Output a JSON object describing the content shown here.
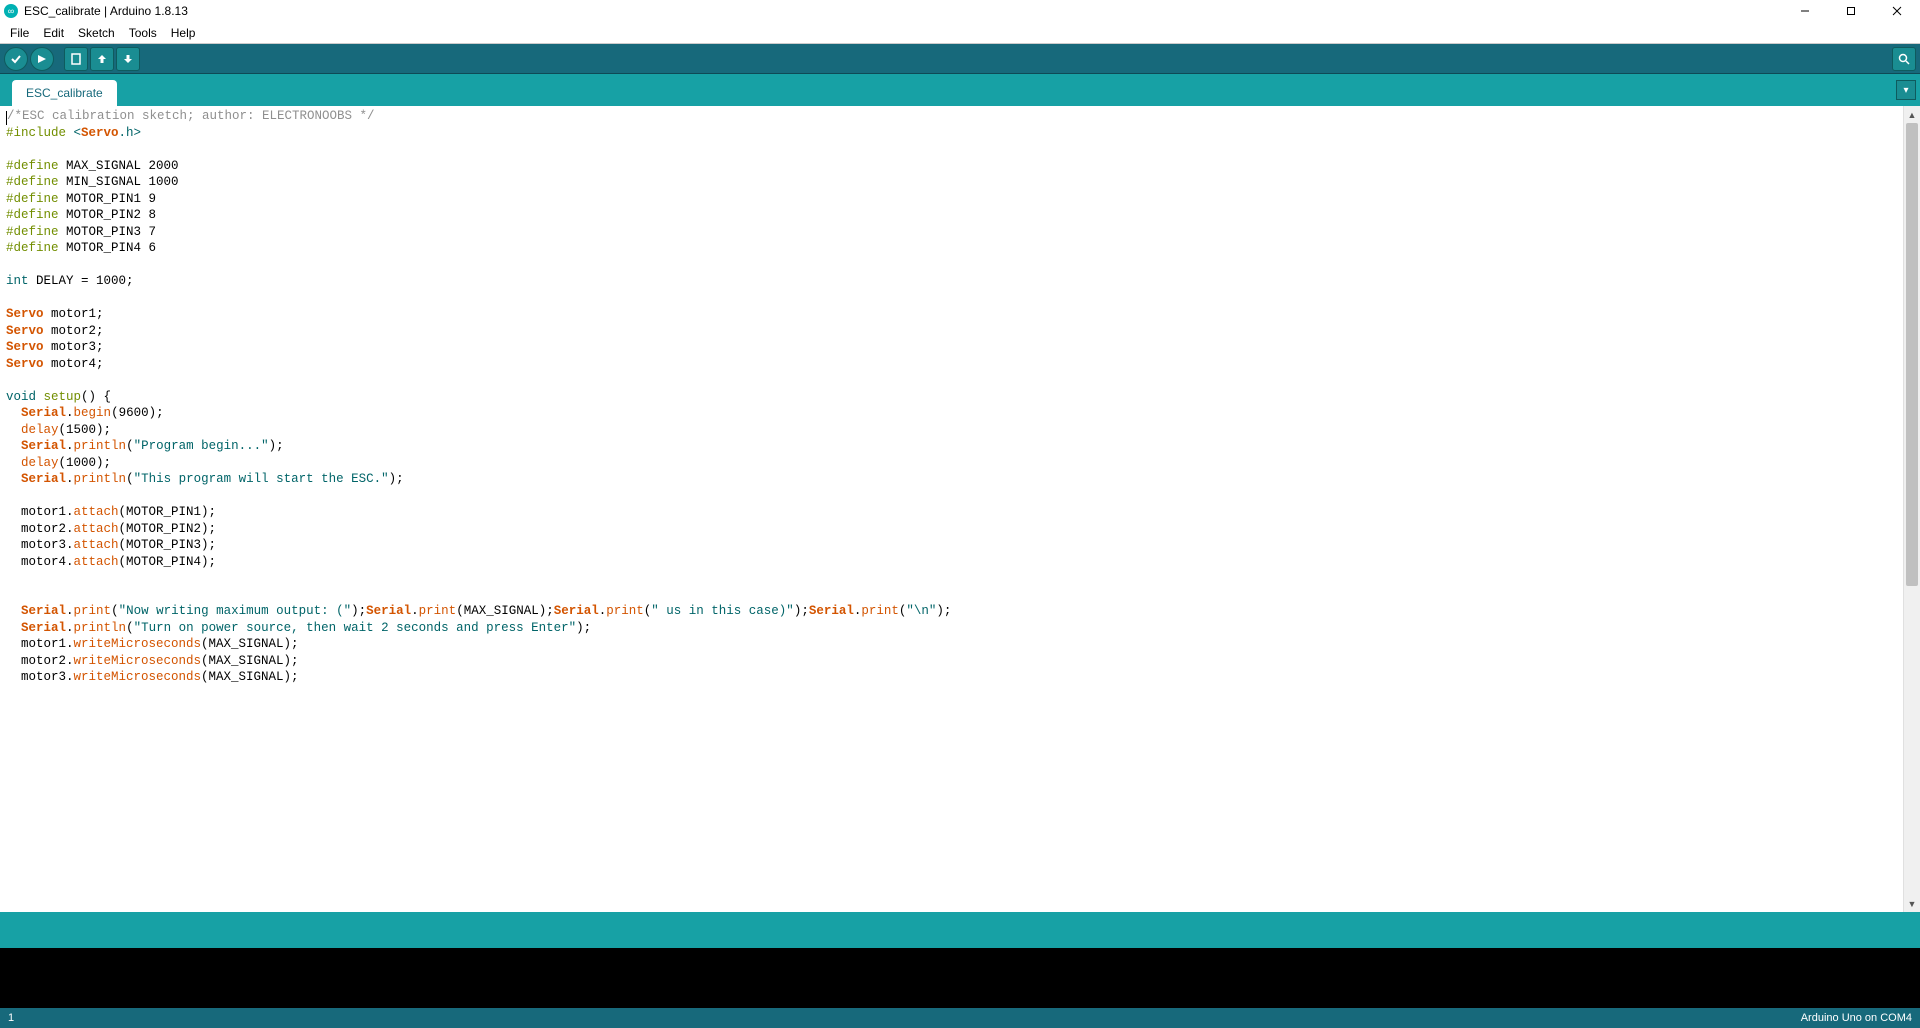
{
  "window": {
    "title": "ESC_calibrate | Arduino 1.8.13"
  },
  "menu": {
    "file": "File",
    "edit": "Edit",
    "sketch": "Sketch",
    "tools": "Tools",
    "help": "Help"
  },
  "icons": {
    "verify": "verify-icon",
    "upload": "upload-icon",
    "new": "new-icon",
    "open": "open-icon",
    "save": "save-icon",
    "serial": "serial-monitor-icon",
    "tab_menu": "tab-menu-icon"
  },
  "tab": {
    "name": "ESC_calibrate"
  },
  "code_lines": [
    [
      [
        "comment",
        "/*ESC calibration sketch; author: ELECTRONOOBS */"
      ]
    ],
    [
      [
        "pre",
        "#include "
      ],
      [
        "sys",
        "<"
      ],
      [
        "core",
        "Servo"
      ],
      [
        "sys",
        ".h>"
      ]
    ],
    [],
    [
      [
        "pre",
        "#define"
      ],
      [
        "plain",
        " MAX_SIGNAL 2000"
      ]
    ],
    [
      [
        "pre",
        "#define"
      ],
      [
        "plain",
        " MIN_SIGNAL 1000"
      ]
    ],
    [
      [
        "pre",
        "#define"
      ],
      [
        "plain",
        " MOTOR_PIN1 9"
      ]
    ],
    [
      [
        "pre",
        "#define"
      ],
      [
        "plain",
        " MOTOR_PIN2 8"
      ]
    ],
    [
      [
        "pre",
        "#define"
      ],
      [
        "plain",
        " MOTOR_PIN3 7"
      ]
    ],
    [
      [
        "pre",
        "#define"
      ],
      [
        "plain",
        " MOTOR_PIN4 6"
      ]
    ],
    [],
    [
      [
        "type",
        "int"
      ],
      [
        "plain",
        " DELAY = 1000;"
      ]
    ],
    [],
    [
      [
        "core",
        "Servo"
      ],
      [
        "plain",
        " motor1;"
      ]
    ],
    [
      [
        "core",
        "Servo"
      ],
      [
        "plain",
        " motor2;"
      ]
    ],
    [
      [
        "core",
        "Servo"
      ],
      [
        "plain",
        " motor3;"
      ]
    ],
    [
      [
        "core",
        "Servo"
      ],
      [
        "plain",
        " motor4;"
      ]
    ],
    [],
    [
      [
        "type",
        "void"
      ],
      [
        "plain",
        " "
      ],
      [
        "kw",
        "setup"
      ],
      [
        "plain",
        "() {"
      ]
    ],
    [
      [
        "plain",
        "  "
      ],
      [
        "core",
        "Serial"
      ],
      [
        "plain",
        "."
      ],
      [
        "fn",
        "begin"
      ],
      [
        "plain",
        "(9600);"
      ]
    ],
    [
      [
        "plain",
        "  "
      ],
      [
        "fn",
        "delay"
      ],
      [
        "plain",
        "(1500);"
      ]
    ],
    [
      [
        "plain",
        "  "
      ],
      [
        "core",
        "Serial"
      ],
      [
        "plain",
        "."
      ],
      [
        "fn",
        "println"
      ],
      [
        "plain",
        "("
      ],
      [
        "str",
        "\"Program begin...\""
      ],
      [
        "plain",
        ");"
      ]
    ],
    [
      [
        "plain",
        "  "
      ],
      [
        "fn",
        "delay"
      ],
      [
        "plain",
        "(1000);"
      ]
    ],
    [
      [
        "plain",
        "  "
      ],
      [
        "core",
        "Serial"
      ],
      [
        "plain",
        "."
      ],
      [
        "fn",
        "println"
      ],
      [
        "plain",
        "("
      ],
      [
        "str",
        "\"This program will start the ESC.\""
      ],
      [
        "plain",
        ");"
      ]
    ],
    [],
    [
      [
        "plain",
        "  motor1."
      ],
      [
        "fn",
        "attach"
      ],
      [
        "plain",
        "(MOTOR_PIN1);"
      ]
    ],
    [
      [
        "plain",
        "  motor2."
      ],
      [
        "fn",
        "attach"
      ],
      [
        "plain",
        "(MOTOR_PIN2);"
      ]
    ],
    [
      [
        "plain",
        "  motor3."
      ],
      [
        "fn",
        "attach"
      ],
      [
        "plain",
        "(MOTOR_PIN3);"
      ]
    ],
    [
      [
        "plain",
        "  motor4."
      ],
      [
        "fn",
        "attach"
      ],
      [
        "plain",
        "(MOTOR_PIN4);"
      ]
    ],
    [],
    [],
    [
      [
        "plain",
        "  "
      ],
      [
        "core",
        "Serial"
      ],
      [
        "plain",
        "."
      ],
      [
        "fn",
        "print"
      ],
      [
        "plain",
        "("
      ],
      [
        "str",
        "\"Now writing maximum output: (\""
      ],
      [
        "plain",
        ");"
      ],
      [
        "core",
        "Serial"
      ],
      [
        "plain",
        "."
      ],
      [
        "fn",
        "print"
      ],
      [
        "plain",
        "(MAX_SIGNAL);"
      ],
      [
        "core",
        "Serial"
      ],
      [
        "plain",
        "."
      ],
      [
        "fn",
        "print"
      ],
      [
        "plain",
        "("
      ],
      [
        "str",
        "\" us in this case)\""
      ],
      [
        "plain",
        ");"
      ],
      [
        "core",
        "Serial"
      ],
      [
        "plain",
        "."
      ],
      [
        "fn",
        "print"
      ],
      [
        "plain",
        "("
      ],
      [
        "str",
        "\"\\n\""
      ],
      [
        "plain",
        ");"
      ]
    ],
    [
      [
        "plain",
        "  "
      ],
      [
        "core",
        "Serial"
      ],
      [
        "plain",
        "."
      ],
      [
        "fn",
        "println"
      ],
      [
        "plain",
        "("
      ],
      [
        "str",
        "\"Turn on power source, then wait 2 seconds and press Enter\""
      ],
      [
        "plain",
        ");"
      ]
    ],
    [
      [
        "plain",
        "  motor1."
      ],
      [
        "fn",
        "writeMicroseconds"
      ],
      [
        "plain",
        "(MAX_SIGNAL);"
      ]
    ],
    [
      [
        "plain",
        "  motor2."
      ],
      [
        "fn",
        "writeMicroseconds"
      ],
      [
        "plain",
        "(MAX_SIGNAL);"
      ]
    ],
    [
      [
        "plain",
        "  motor3."
      ],
      [
        "fn",
        "writeMicroseconds"
      ],
      [
        "plain",
        "(MAX_SIGNAL);"
      ]
    ]
  ],
  "footer": {
    "line": "1",
    "board": "Arduino Uno on COM4"
  }
}
